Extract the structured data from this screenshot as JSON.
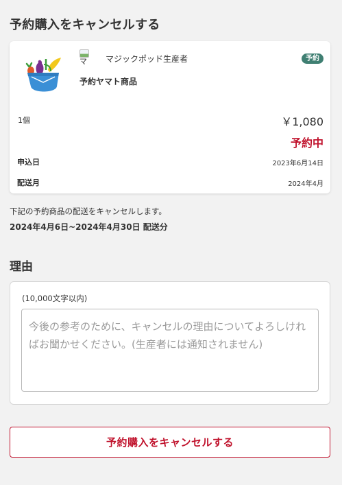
{
  "page": {
    "title": "予約購入をキャンセルする"
  },
  "product": {
    "avatar_alt": "マ",
    "producer_name": "マジックポッド生産者",
    "badge": "予約",
    "name": "予約ヤマト商品",
    "quantity": "1個",
    "price": "￥1,080",
    "status": "予約中",
    "status_color": "#c0122c",
    "applied_date_label": "申込日",
    "applied_date": "2023年6月14日",
    "delivery_month_label": "配送月",
    "delivery_month": "2024年4月"
  },
  "notice": {
    "text": "下記の予約商品の配送をキャンセルします。",
    "period": "2024年4月6日~2024年4月30日 配送分"
  },
  "reason": {
    "heading": "理由",
    "char_limit": "(10,000文字以内)",
    "value": "",
    "placeholder": "今後の参考のために、キャンセルの理由についてよろしければお聞かせください。(生産者には通知されません)"
  },
  "actions": {
    "cancel_label": "予約購入をキャンセルする"
  },
  "colors": {
    "accent": "#c0122c",
    "badge": "#3f7f72",
    "background": "#f2f2f2"
  }
}
